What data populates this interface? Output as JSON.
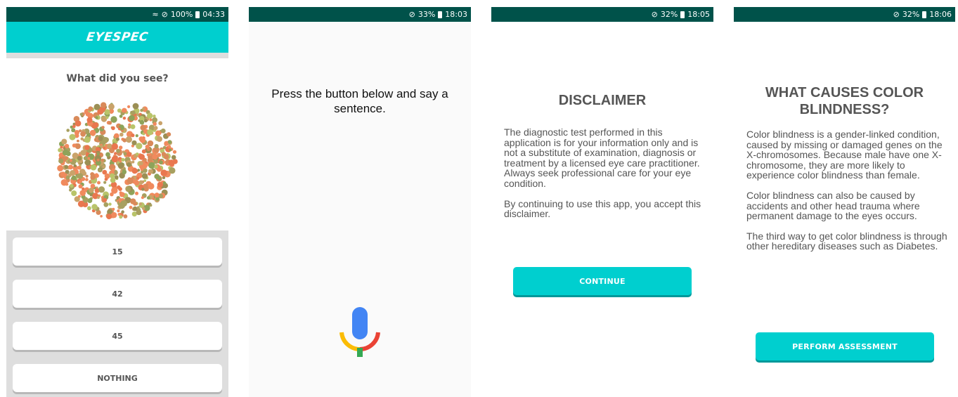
{
  "screen1": {
    "status": {
      "battery": "100%",
      "time": "04:33"
    },
    "header": {
      "logo": "EYESPEC"
    },
    "question": "What did you see?",
    "answers": [
      "15",
      "42",
      "45",
      "NOTHING"
    ]
  },
  "screen2": {
    "status": {
      "battery": "33%",
      "time": "18:03"
    },
    "prompt": "Press the button below and say a sentence."
  },
  "screen3": {
    "status": {
      "battery": "32%",
      "time": "18:05"
    },
    "title": "DISCLAIMER",
    "paragraph1": "The diagnostic test performed in this application is for your information only and is not a substitute of examination, diagnosis or treatment by a licensed eye care practitioner. Always seek professional care for your eye condition.",
    "paragraph2": "By continuing to use this app, you accept this disclaimer.",
    "button": "CONTINUE"
  },
  "screen4": {
    "status": {
      "battery": "32%",
      "time": "18:06"
    },
    "title": "WHAT CAUSES COLOR BLINDNESS?",
    "paragraph1": "Color blindness is a gender-linked condition, caused by missing or damaged genes on the X-chromosomes. Because male have one X-chromosome, they are more likely to experience color blindness than female.",
    "paragraph2": "Color blindness can also be caused by accidents and other head trauma where permanent damage to the eyes occurs.",
    "paragraph3": "The third way to get color blindness is through other hereditary diseases such as Diabetes.",
    "button": "PERFORM ASSESSMENT"
  },
  "colors": {
    "status_bar": "#00524a",
    "accent": "#00cfcf",
    "text_gray": "#555555",
    "plate_orange": "#f08a5d",
    "plate_olive": "#a8a060",
    "plate_green": "#b9c46a",
    "mic_blue": "#4285f4",
    "mic_red": "#ea4335",
    "mic_yellow": "#fbbc05",
    "mic_green": "#34a853"
  }
}
